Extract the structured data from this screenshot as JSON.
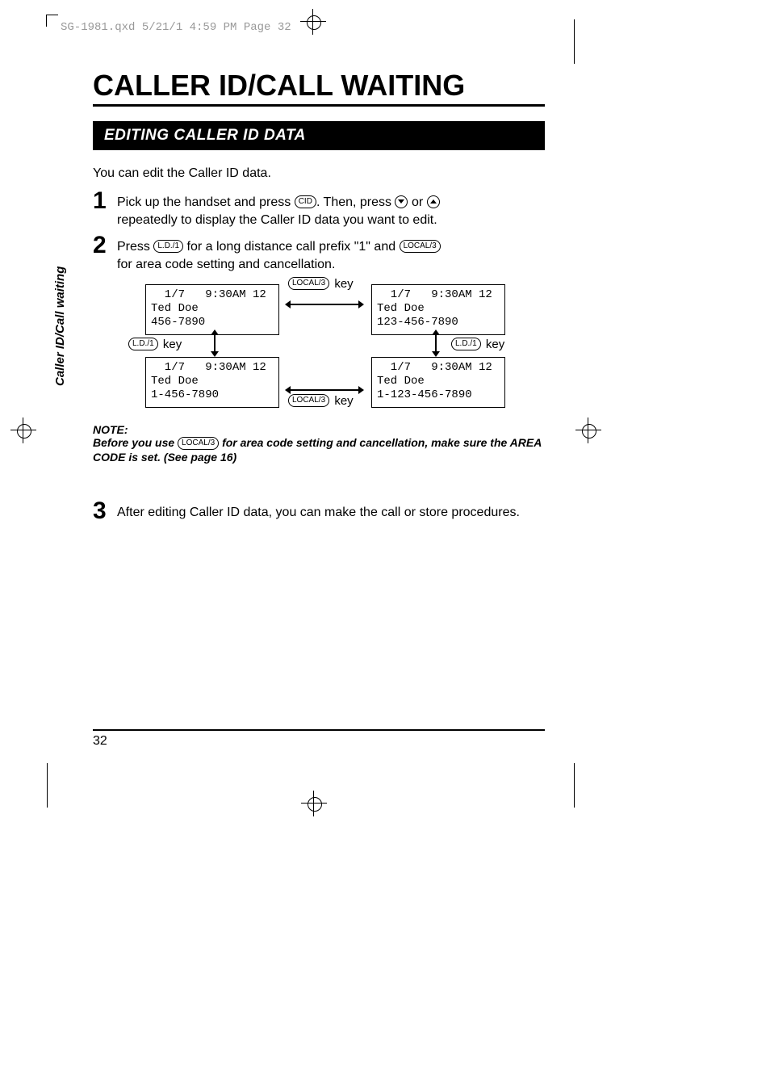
{
  "header": {
    "filemeta": "SG-1981.qxd  5/21/1 4:59 PM  Page 32"
  },
  "title": "CALLER ID/CALL WAITING",
  "section_bar": "EDITING CALLER ID DATA",
  "intro": "You can edit the Caller ID data.",
  "keys": {
    "cid": "CID",
    "ld1": "L.D./1",
    "local3": "LOCAL/3"
  },
  "words": {
    "key": "key",
    "or": "or"
  },
  "steps": {
    "s1": {
      "num": "1",
      "a": "Pick up the handset and press",
      "b": ". Then, press",
      "c": "repeatedly to display the Caller ID data you want to edit."
    },
    "s2": {
      "num": "2",
      "a": "Press",
      "b": "for a long distance call prefix \"1\" and",
      "c": "for area code setting and cancellation."
    },
    "s3": {
      "num": "3",
      "body": "After editing Caller ID data, you can make the call or store procedures."
    }
  },
  "lcds": {
    "tl_l1": "  1/7   9:30AM 12",
    "tl_l2": "Ted Doe",
    "tl_l3": "456-7890",
    "bl_l1": "  1/7   9:30AM 12",
    "bl_l2": "Ted Doe",
    "bl_l3": "1-456-7890",
    "tr_l1": "  1/7   9:30AM 12",
    "tr_l2": "Ted Doe",
    "tr_l3": "123-456-7890",
    "br_l1": "  1/7   9:30AM 12",
    "br_l2": "Ted Doe",
    "br_l3": "1-123-456-7890"
  },
  "note": {
    "hd": "NOTE:",
    "a": "Before you use",
    "b": "for area code setting and cancellation, make sure the AREA CODE is set. (See page 16)"
  },
  "sidetab": "Caller ID/Call waiting",
  "pagenum": "32"
}
